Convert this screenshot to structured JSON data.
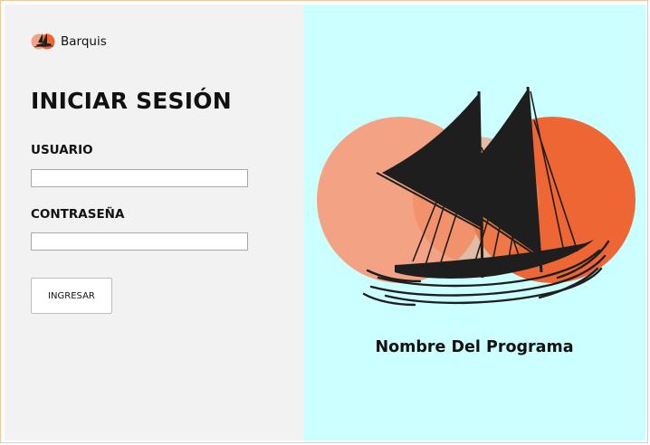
{
  "brand": {
    "name": "Barquis",
    "logo_icon": "sailboat-logo-icon"
  },
  "login": {
    "title": "INICIAR SESIÓN",
    "username_label": "USUARIO",
    "username_value": "",
    "password_label": "CONTRASEÑA",
    "password_value": "",
    "submit_label": "INGRESAR"
  },
  "hero": {
    "app_name": "Nombre Del Programa",
    "illustration_icon": "sailboat-sunset-illustration"
  },
  "colors": {
    "left_background": "#f2f2f2",
    "right_background": "#ccffff",
    "circle_light": "#f3a283",
    "circle_dark": "#ee6633",
    "sail_color": "#1e1e1e",
    "window_border": "#f3c89a"
  }
}
